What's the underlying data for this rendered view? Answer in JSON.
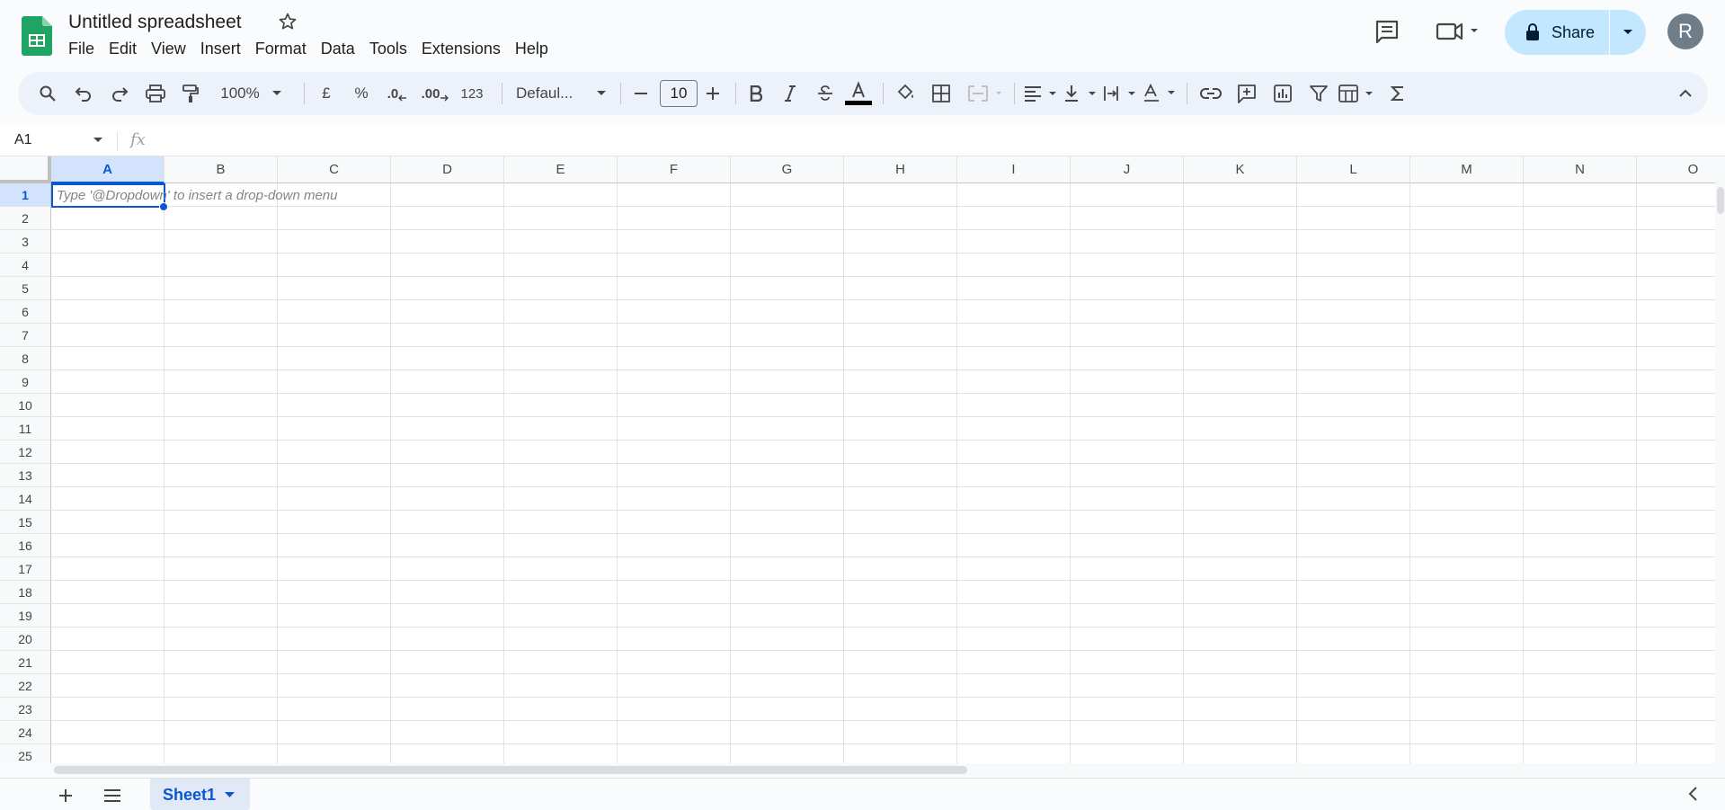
{
  "header": {
    "title": "Untitled spreadsheet",
    "menus": [
      "File",
      "Edit",
      "View",
      "Insert",
      "Format",
      "Data",
      "Tools",
      "Extensions",
      "Help"
    ],
    "share_label": "Share",
    "avatar_letter": "R"
  },
  "toolbar": {
    "zoom": "100%",
    "currency": "£",
    "percent": "%",
    "dec_decrease": ".0",
    "dec_increase": ".00",
    "number_format": "123",
    "font": "Defaul...",
    "font_size": "10"
  },
  "formula_bar": {
    "name_box": "A1",
    "fx_label": "fx"
  },
  "grid": {
    "columns": [
      "A",
      "B",
      "C",
      "D",
      "E",
      "F",
      "G",
      "H",
      "I",
      "J",
      "K",
      "L",
      "M",
      "N",
      "O"
    ],
    "rows": [
      "1",
      "2",
      "3",
      "4",
      "5",
      "6",
      "7",
      "8",
      "9",
      "10",
      "11",
      "12",
      "13",
      "14",
      "15",
      "16",
      "17",
      "18",
      "19",
      "20",
      "21",
      "22",
      "23",
      "24",
      "25"
    ],
    "active_cell": "A1",
    "hint": "Type '@Dropdown' to insert a drop-down menu"
  },
  "sheets": {
    "active": "Sheet1"
  },
  "colors": {
    "accent": "#0b57d0",
    "share_bg": "#c2e7ff",
    "sheets_green": "#0f9d58"
  }
}
